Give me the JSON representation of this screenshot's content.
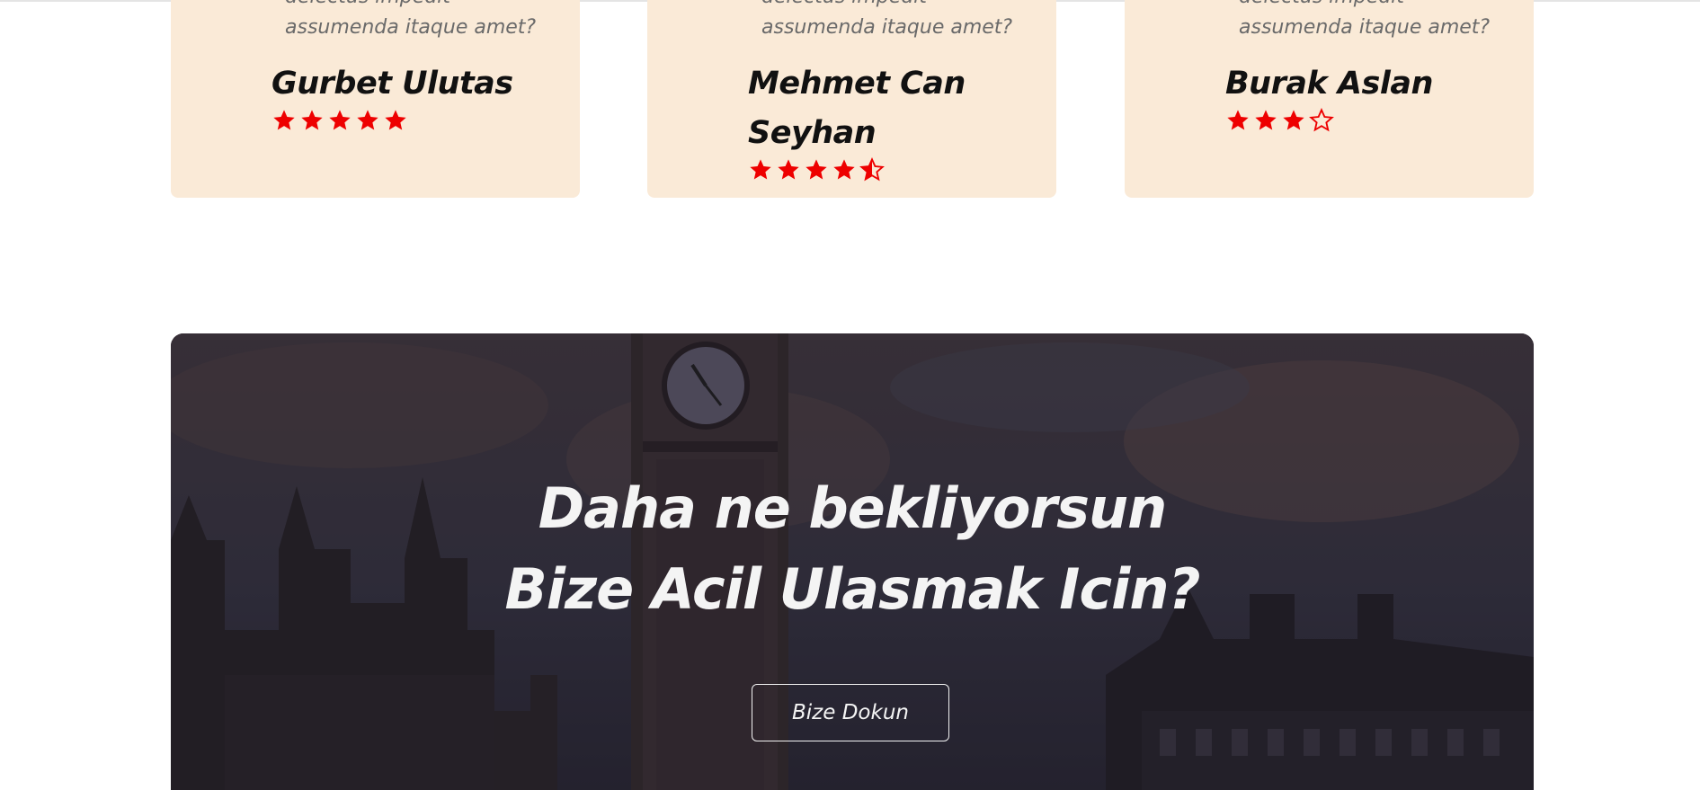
{
  "testimonials": [
    {
      "quote_line_1": "delectus impedit",
      "quote_line_2": "assumenda itaque amet?",
      "name": "Gurbet Ulutas",
      "rating": 5
    },
    {
      "quote_line_1": "delectus impedit",
      "quote_line_2": "assumenda itaque amet?",
      "name": "Mehmet Can Seyhan",
      "rating": 4.5
    },
    {
      "quote_line_1": "delectus impedit",
      "quote_line_2": "assumenda itaque amet?",
      "name": "Burak Aslan",
      "rating": 3
    }
  ],
  "cta": {
    "headline_line_1": "Daha ne bekliyorsun",
    "headline_line_2": "Bize Acil Ulasmak Icin?",
    "button_label": "Bize Dokun"
  },
  "colors": {
    "card_background": "#faead7",
    "star": "#ee0000",
    "name": "#111111",
    "quote": "#6a6a6a",
    "cta_text": "#f4f4f4"
  },
  "icons": {
    "star_full": "star-icon",
    "star_half": "star-half-icon",
    "star_empty": "star-empty-icon"
  }
}
